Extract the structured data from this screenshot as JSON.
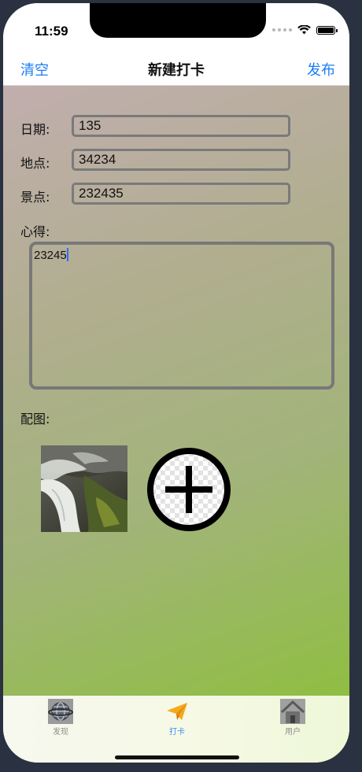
{
  "status": {
    "time": "11:59"
  },
  "nav": {
    "left": "清空",
    "title": "新建打卡",
    "right": "发布"
  },
  "form": {
    "date_label": "日期:",
    "date_value": "135",
    "place_label": "地点:",
    "place_value": "34234",
    "scenic_label": "景点:",
    "scenic_value": "232435",
    "notes_label": "心得:",
    "notes_value": "23245",
    "images_label": "配图:"
  },
  "images": [
    {
      "icon": "waterfall-photo"
    }
  ],
  "tabs": [
    {
      "label": "发现",
      "icon": "globe-icon",
      "active": false
    },
    {
      "label": "打卡",
      "icon": "paper-plane-icon",
      "active": true
    },
    {
      "label": "用户",
      "icon": "house-icon",
      "active": false
    }
  ],
  "colors": {
    "accent": "#1a7cf5",
    "active_tab": "#3b8cf0",
    "field_border": "#7a7a7a"
  }
}
